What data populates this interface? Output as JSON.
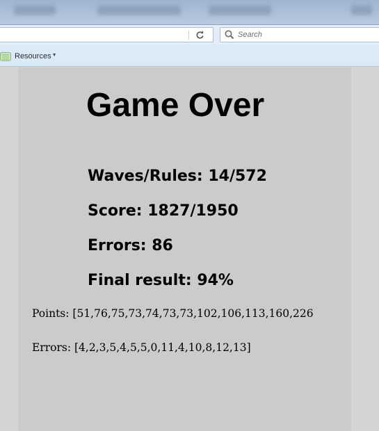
{
  "browser": {
    "search_placeholder": "Search",
    "bookmarks": [
      {
        "label": "Resources",
        "icon": "folder-icon"
      }
    ]
  },
  "page": {
    "title": "Game Over",
    "stats": {
      "waves_rules": "Waves/Rules: 14/572",
      "score": "Score: 1827/1950",
      "errors": "Errors: 86",
      "final_result": "Final result: 94%"
    },
    "points_line": "Points: [51,76,75,73,74,73,73,102,106,113,160,226",
    "errors_line": "Errors: [4,2,3,5,4,5,5,0,11,4,10,8,12,13]"
  }
}
